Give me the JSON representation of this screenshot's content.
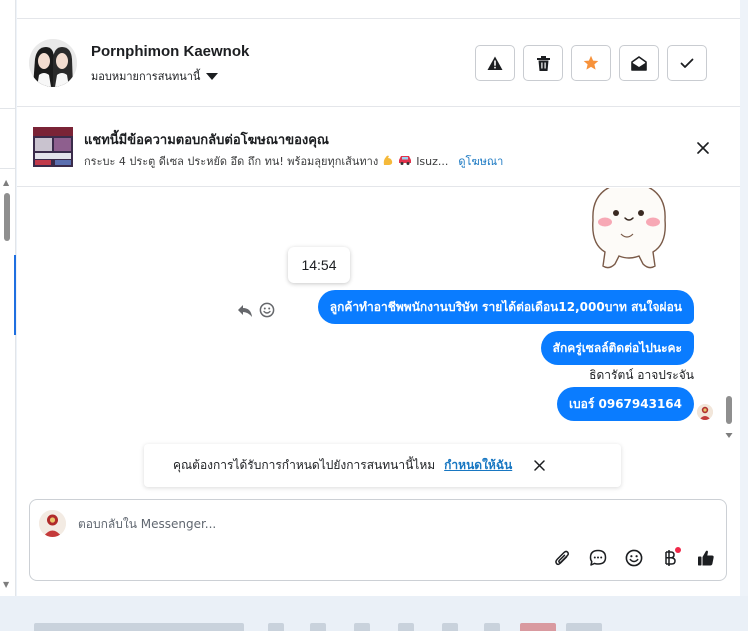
{
  "header": {
    "contact_name": "Pornphimon Kaewnok",
    "assign_label": "มอบหมายการสนทนานี้",
    "actions": [
      {
        "name": "spam-button",
        "icon": "warning-icon"
      },
      {
        "name": "delete-button",
        "icon": "trash-icon"
      },
      {
        "name": "star-button",
        "icon": "star-icon"
      },
      {
        "name": "mark-unread-button",
        "icon": "envelope-open-icon"
      },
      {
        "name": "done-button",
        "icon": "check-icon"
      }
    ]
  },
  "ad_banner": {
    "title": "แชทนี้มีข้อความตอบกลับต่อโฆษณาของคุณ",
    "description": "กระบะ 4 ประตู ดีเซล ประหยัด อึด ถึก ทน! พร้อมลุยทุกเส้นทาง",
    "description_tail": "Isuz...",
    "link": "ดูโฆษณา"
  },
  "conversation": {
    "timestamp": "14:54",
    "messages": [
      {
        "text": "ลูกค้าทำอาชีพพนักงานบริษัท รายได้ต่อเดือน12,000บาท สนใจผ่อน"
      },
      {
        "text": "สักครู่เซลล์ติดต่อไปนะคะ"
      },
      {
        "text": "เบอร์ 0967943164"
      }
    ],
    "sender_name": "ธิดารัตน์ อาจประจัน"
  },
  "assign_prompt": {
    "text": "คุณต้องการได้รับการกำหนดไปยังการสนทนานี้ไหม",
    "link": "กำหนดให้ฉัน"
  },
  "composer": {
    "placeholder": "ตอบกลับใน Messenger...",
    "tools": [
      "paperclip-icon",
      "saved-reply-icon",
      "emoji-icon",
      "baht-icon",
      "thumbs-up-icon"
    ]
  },
  "colors": {
    "bubble": "#0a7cff",
    "link": "#1877c2",
    "star": "#f7923b",
    "notification_dot": "#f02849"
  }
}
